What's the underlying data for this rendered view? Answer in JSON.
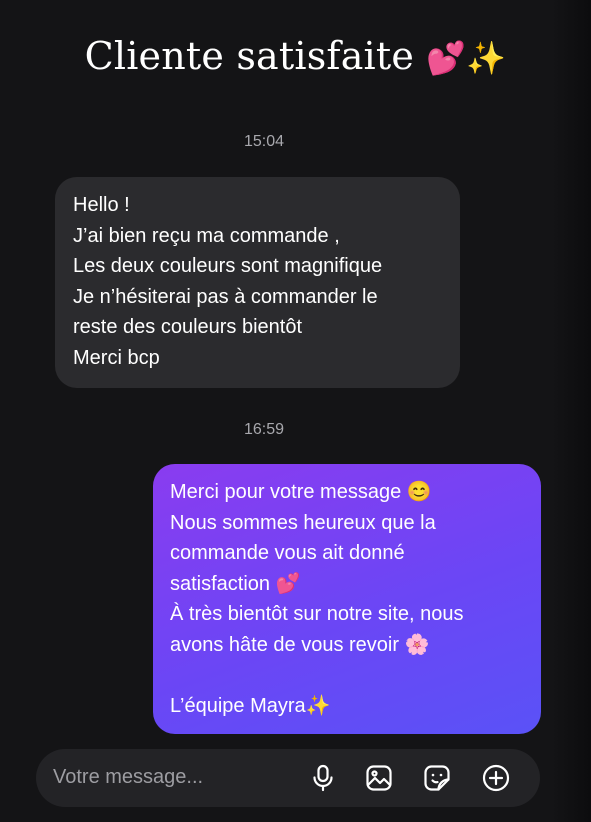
{
  "header": {
    "title": "Cliente satisfaite",
    "title_emoji": "💕✨"
  },
  "conversation": {
    "timestamps": [
      "15:04",
      "16:59"
    ],
    "received_message": {
      "lines": [
        "Hello !",
        "J’ai bien reçu ma commande ,",
        "Les deux couleurs sont magnifique",
        "Je n’hésiterai pas à commander le",
        "reste des couleurs bientôt",
        "Merci bcp"
      ]
    },
    "sent_message": {
      "lines": [
        "Merci pour votre message 😊",
        "Nous sommes heureux que la",
        "commande vous ait donné",
        "satisfaction 💕",
        "À très bientôt sur notre site, nous",
        "avons hâte de vous revoir 🌸",
        "",
        "L’équipe Mayra✨"
      ]
    }
  },
  "composer": {
    "placeholder": "Votre message...",
    "icons": [
      "microphone-icon",
      "image-icon",
      "sticker-icon",
      "plus-circle-icon"
    ]
  },
  "colors": {
    "background": "#141416",
    "received_bubble": "#2b2b2e",
    "sent_bubble_start": "#8a3cf0",
    "sent_bubble_end": "#5a52f7"
  }
}
